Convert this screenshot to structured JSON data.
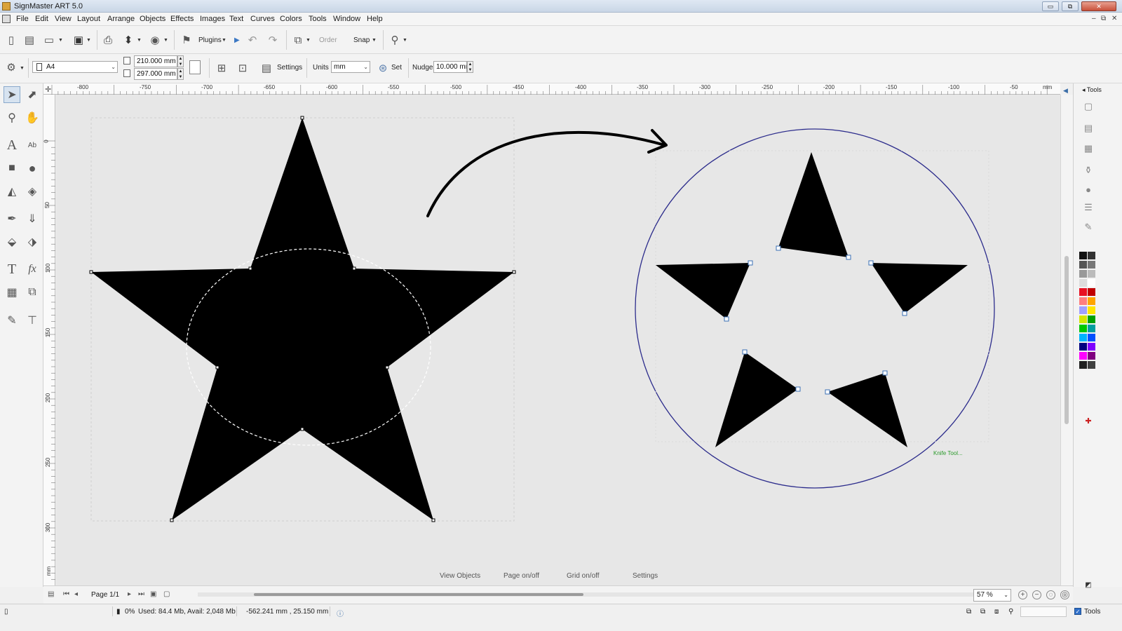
{
  "window": {
    "title": "SignMaster ART 5.0",
    "minimize_label": "▭",
    "restore_label": "⧉",
    "close_label": "✕",
    "mdi_minimize": "–",
    "mdi_restore": "⧉",
    "mdi_close": "✕"
  },
  "menu": {
    "items": [
      "File",
      "Edit",
      "View",
      "Layout",
      "Arrange",
      "Objects",
      "Effects",
      "Images",
      "Text",
      "Curves",
      "Colors",
      "Tools",
      "Window",
      "Help"
    ]
  },
  "toolbar1": {
    "plugins_label": "Plugins",
    "order_label": "Order",
    "snap_label": "Snap"
  },
  "toolbar2": {
    "page_size": "A4",
    "width": "210.000 mm",
    "height": "297.000 mm",
    "settings_label": "Settings",
    "units_label": "Units",
    "units_value": "mm",
    "set_label": "Set",
    "nudge_label": "Nudge",
    "nudge_value": "10.000 mm"
  },
  "ruler": {
    "h_labels": [
      "-800",
      "-750",
      "-700",
      "-650",
      "-600",
      "-550",
      "-500",
      "-450",
      "-400",
      "-350",
      "-300",
      "-250",
      "-200",
      "-150",
      "-100",
      "-50"
    ],
    "h_unit": "mm",
    "v_labels": [
      "0",
      "50",
      "100",
      "150",
      "200",
      "250",
      "300"
    ],
    "v_unit": "mm"
  },
  "canvas": {
    "knife_tool_label": "Knife Tool...",
    "links": [
      "View Objects",
      "Page on/off",
      "Grid on/off",
      "Settings"
    ]
  },
  "pagenav": {
    "page_label": "Page 1/1",
    "zoom_value": "57 %"
  },
  "status": {
    "percent": "0%",
    "memory": "Used: 84.4 Mb, Avail: 2,048 Mb",
    "coords": "-562.241 mm , 25.150 mm",
    "tools_label": "Tools"
  },
  "rightpanel": {
    "tools_tab": "Tools"
  },
  "icons": {
    "select": "select-arrow-icon",
    "node_edit": "node-edit-icon",
    "zoom": "zoom-icon",
    "pan": "hand-icon",
    "text": "text-icon",
    "artistic_text": "artistic-text-icon",
    "rectangle": "rectangle-icon",
    "ellipse": "ellipse-icon"
  },
  "palette": [
    "#111111",
    "#333333",
    "#555555",
    "#777777",
    "#999999",
    "#bbbbbb",
    "#dddddd",
    "#ffffff",
    "#e81123",
    "#c00000",
    "#ff7f7f",
    "#ffa500",
    "#a0a0ff",
    "#ffe600",
    "#d4e600",
    "#00a000",
    "#00c800",
    "#009e9e",
    "#00b4ff",
    "#0050ff",
    "#000080",
    "#7f00ff",
    "#ff00ff",
    "#800080",
    "#202020",
    "#404040"
  ]
}
